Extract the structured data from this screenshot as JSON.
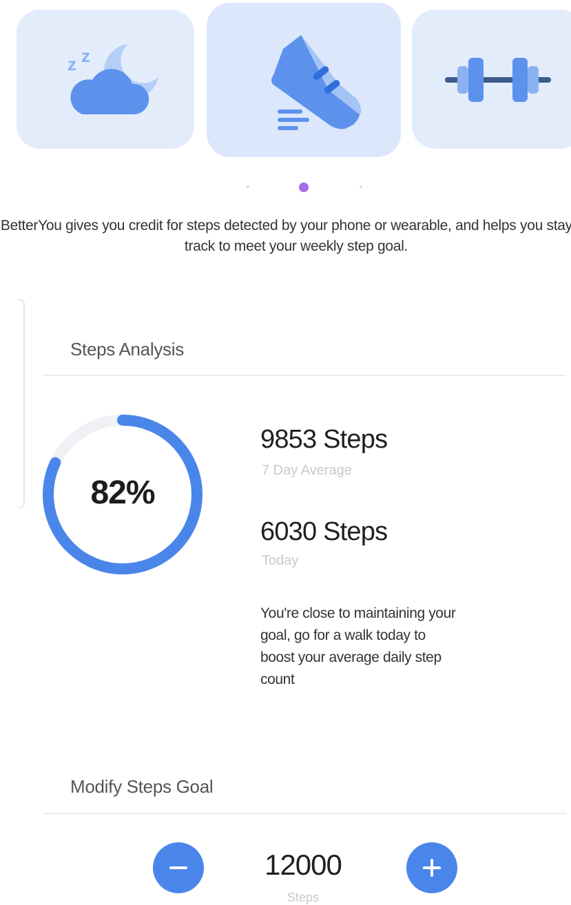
{
  "carousel": {
    "cards": [
      {
        "id": "sleep",
        "icon": "moon-cloud-icon"
      },
      {
        "id": "steps",
        "icon": "sneaker-icon",
        "active": true
      },
      {
        "id": "strength",
        "icon": "dumbbell-icon"
      }
    ],
    "page_count": 3,
    "active_index": 1,
    "description": "BetterYou gives you credit for steps detected by your phone or wearable, and helps you stay on track to meet your weekly step goal."
  },
  "steps_analysis": {
    "title": "Steps Analysis",
    "progress_percent": 82,
    "progress_label": "82%",
    "average": {
      "value": "9853 Steps",
      "label": "7 Day Average"
    },
    "today": {
      "value": "6030 Steps",
      "label": "Today"
    },
    "tip": "You're close to maintaining your goal, go for a walk today to boost your average daily step count"
  },
  "goal": {
    "title": "Modify Steps Goal",
    "value": "12000",
    "unit": "Steps"
  },
  "colors": {
    "accent": "#4a86ea",
    "card_bg": "#e3ecfb",
    "dot_active": "#a66ce6",
    "ring_track": "#f0f1f5"
  }
}
